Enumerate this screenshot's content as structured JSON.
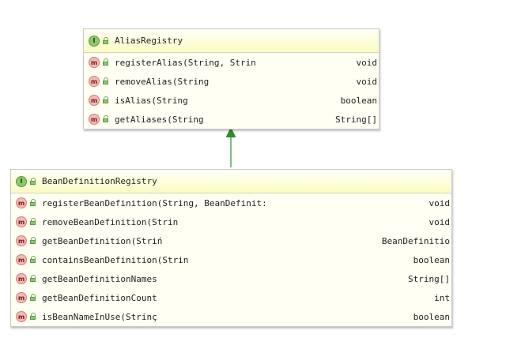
{
  "alias_registry": {
    "name": "AliasRegistry",
    "kind_badge": "I",
    "methods": [
      {
        "badge": "m",
        "name": "registerAlias(String, Strin",
        "returns": "void"
      },
      {
        "badge": "m",
        "name": "removeAlias(String",
        "returns": "void"
      },
      {
        "badge": "m",
        "name": "isAlias(String",
        "returns": "boolean"
      },
      {
        "badge": "m",
        "name": "getAliases(String",
        "returns": "String[]"
      }
    ]
  },
  "bean_definition_registry": {
    "name": "BeanDefinitionRegistry",
    "kind_badge": "I",
    "methods": [
      {
        "badge": "m",
        "name": "registerBeanDefinition(String, BeanDefinit:",
        "returns": "void"
      },
      {
        "badge": "m",
        "name": "removeBeanDefinition(Strin",
        "returns": "void"
      },
      {
        "badge": "m",
        "name": "getBeanDefinition(Striń",
        "returns": "BeanDefinitio"
      },
      {
        "badge": "m",
        "name": "containsBeanDefinition(Strin",
        "returns": "boolean"
      },
      {
        "badge": "m",
        "name": "getBeanDefinitionNames",
        "returns": "String[]"
      },
      {
        "badge": "m",
        "name": "getBeanDefinitionCount",
        "returns": "int"
      },
      {
        "badge": "m",
        "name": "isBeanNameInUse(Strinç",
        "returns": "boolean"
      }
    ]
  },
  "relationship": {
    "type": "extends",
    "from": "BeanDefinitionRegistry",
    "to": "AliasRegistry",
    "color": "#2e8b2e"
  },
  "colors": {
    "interface_badge": "#8ec86e",
    "method_badge": "#f6b9b5",
    "header": "#fcfcc4",
    "body": "#fffff4"
  },
  "icons": {
    "interface": "interface-icon",
    "method": "method-icon",
    "visibility": "public-lock-icon"
  }
}
